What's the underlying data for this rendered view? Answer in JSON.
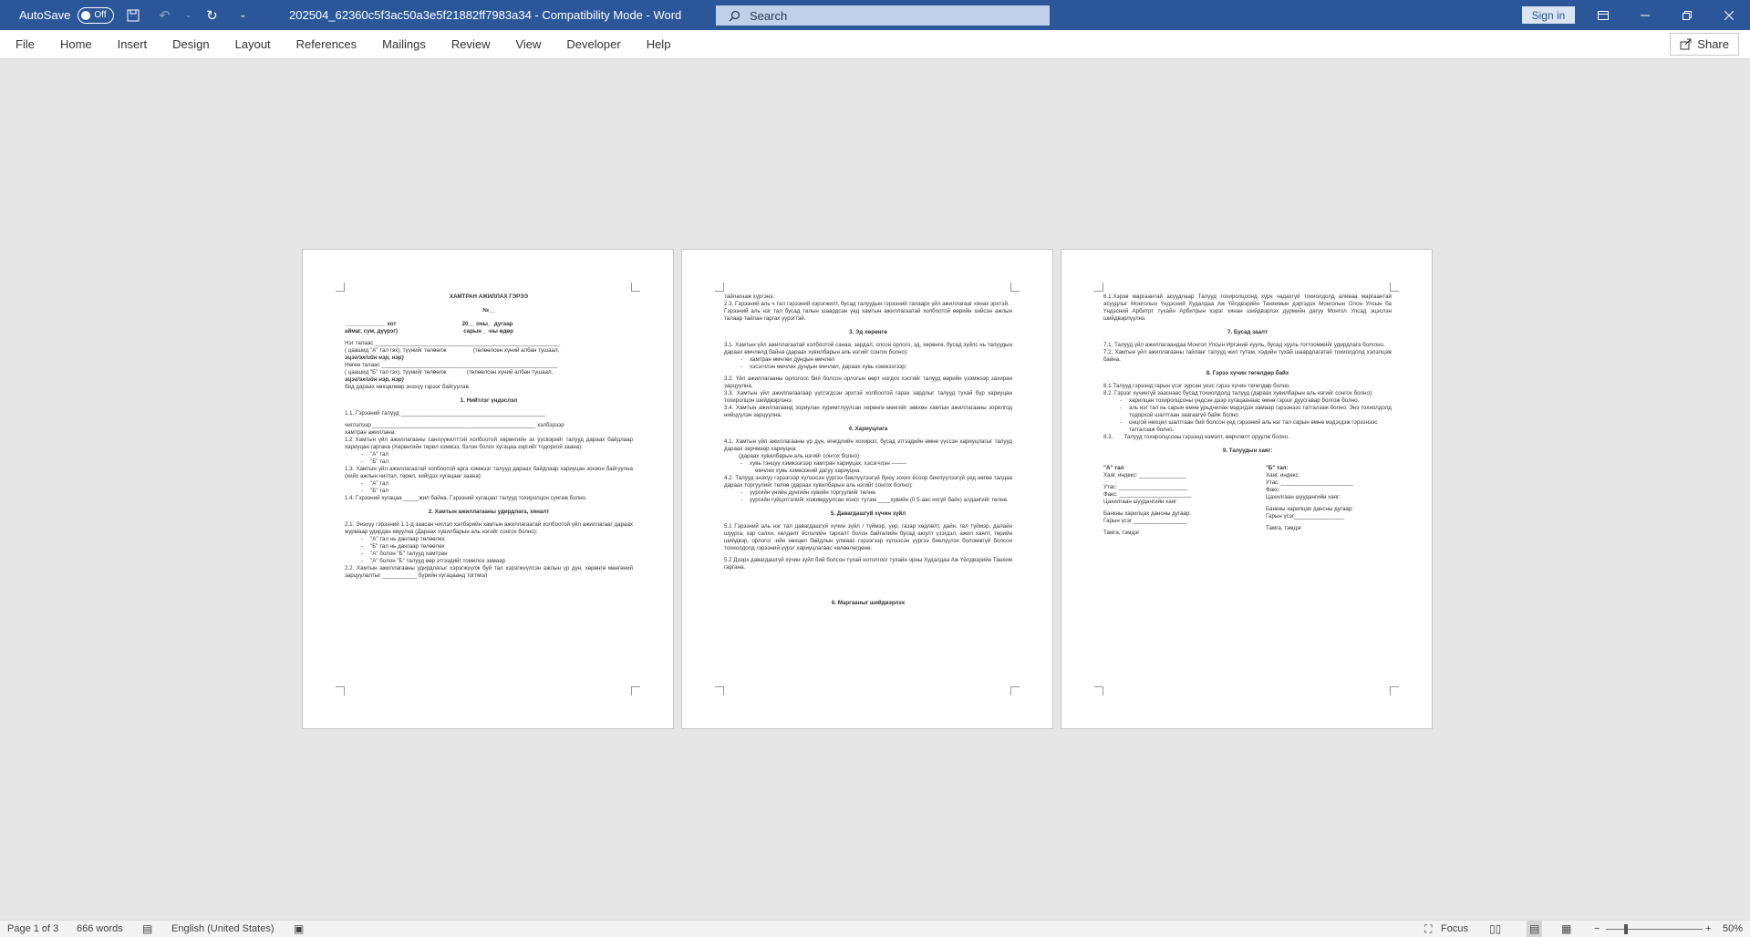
{
  "titlebar": {
    "autosave_label": "AutoSave",
    "autosave_state": "Off",
    "document_title": "202504_62360c5f3ac50a3e5f21882ff7983a34  -  Compatibility Mode  -  Word",
    "search_placeholder": "Search",
    "signin_label": "Sign in"
  },
  "ribbon": {
    "tabs": [
      "File",
      "Home",
      "Insert",
      "Design",
      "Layout",
      "References",
      "Mailings",
      "Review",
      "View",
      "Developer",
      "Help"
    ],
    "share_label": "Share"
  },
  "pages": [
    {
      "title": "ХАМТРАН АЖИЛЛАХ ГЭРЭЭ",
      "number": "№__",
      "city_line": "_____________ хот                                          20__ оны_  дугаар",
      "region_line": "аймаг, сум, дүүрэг)                                          сарын _ -ны өдөр",
      "party_a": "Нэг талаас ___________________________________________________________",
      "party_a_sub": "( цаашид \"А\" тал гэх), түүнийг төлөөлж                 (төлөөлсөн хүний албан тушаал,",
      "party_a_sub2": "эцэг/эх/ийн нэр, нэр)",
      "party_b": "Нөгөө талаас ________________________________________________________",
      "party_b_sub": "( цаашид \"Б\" тал гэх), түүнийг төлөөлж             (төлөөлсөн хүний албан тушаал,",
      "party_b_sub2": "эцэг/эх/ийн нэр, нэр)",
      "intro": "бид дараах нөхцөлөөр энэхүү гэрээг байгуулав.",
      "sec1": "1. Нийтлэг үндэслэл",
      "s1_1": "1.1. Гэрээний талууд ______________________________________________",
      "s1_chiglel": "чиглэлээр ____________________________________________________ хэлбэрээр",
      "s1_tail": "хамтран ажиллана.",
      "s1_2": "1.2 Хамтын үйл ажиллагааны санхүүжилттэй холбоотой хөрөнгийн эх үүсвэрийг талууд дараах байдлаар хариуцан гаргана (Хөрөнгийн төрөл хэмжээ, бэлэн болох хугацаа зэргийг тодорхой заана):",
      "s1_2a": "\"А\" тал",
      "s1_2b": "\"Б\" тал",
      "s1_3": "1.3. Хамтын үйл ажиллагаатай холбоотой арга хэмжээг талууд дараах байдлаар хариуцан зохион байгуулна (хийх ажлын чиглэл, төрөл, хийгдэх хугацааг заана):",
      "s1_3a": "\"А\" тал",
      "s1_3b": "\"Б\" тал",
      "s1_4": "1.4. Гэрээний хугацаа _____жил байна. Гэрээний хугацааг талууд тохиролцон сунгаж болно.",
      "sec2": "2. Хамтын ажиллагааны удирдлага, хяналт",
      "s2_1": "2.1. Энэхүү гэрээний 1.1-д заасан чиглэл хэлбэрийн хамтын ажиллагаатай холбоотой үйл ажиллагааг дараах журмаар удирдан явуулна (Дараах хувилбарын аль нэгийг сонгох болно):",
      "s2_1a": "\"А\" тал нь дангаар төлөөлөх",
      "s2_1b": "\"Б\" тал нь дангаар төлөөлөх",
      "s2_1c": "\"А\" болон \"Б\" талууд хамтран",
      "s2_1d": "\"А\" болон \"Б\" талууд өөр этгээдийг томилох замаар",
      "s2_2": "2.2. Хамтын ажиллагааны удирдлагыг хэрэгжүүлж буй тал хэрэгжүүлсэн ажлын үр дүн, хөрөнгө мөнгөний зарцуулалтыг ___________ бүрийн хугацаанд тогтмол"
    },
    {
      "l1": "тайлагнаж хүргэнэ.",
      "l2": "2.3. Гэрээний аль ч тал гэрээний хэрэгжилт, бусад талуудын гэрээний талаарх үйл ажиллагааг хянах эрхтэй.",
      "l3": "Гэрээний аль нэг тал бусад талын шаардсан үед хамтын ажиллагаатай холбоотой өөрийн хийсэн ажлын талаар тайлан гаргах үүрэгтэй.",
      "sec3": "3. Эд хөрөнгө",
      "s3_1": "3.1. Хамтын үйл ажиллагаатай холбоотой санаа, зардал, олсон орлого, эд, хөрөнгө, бусад зүйлс нь талуудын дараах өмчлөлд байна (дараах хувилбарын аль нэгийг сонгох болно):",
      "s3_1a": "хамтран өмчлөх дундын өмчлөл",
      "s3_1b": "хэсэгчлэн өмчлөх дундын өмчлөл, дараах хувь хэмжээгээр:",
      "s3_2": "3.2. Үйл ажиллагааны орлогоос бий болсон орлогын өөрт ногдох хэсгийг талууд өөрийн үзэмжээр захиран зарцуулна.",
      "s3_3": "3.3. Хамтын үйл ажиллагаагаар үүсгэгдсэн эрхтэй холбоотой гарах зардлыг талууд тухай бүр хариуцан тохиролцон шийдвэрлэнэ.",
      "s3_4": "3.4. Хамтын ажиллагаанд зориулан хуримтлуулсан хөрөнгө мөнгийг зөвхөн хамтын ажиллагааны зорилгод нийцүүлэн зарцуулна.",
      "sec4": "4. Хариуцлага",
      "s4_1": "4.1. Хамтын үйл ажиллагааны үр дүн, өгөгдлийн хохирол, бусад этгээдийн өмнө үүссэн хариуцлагыг талууд дараах зарчмаар хариуцна:",
      "s4_1s": "(дараах хувилбарын аль нэгийг сонгох болно)",
      "s4_1a": "хувь тэнцүү хэмжээгээр хамтран хариуцах, хэсэгчлэн --------",
      "s4_1b": "өмчлөх хувь хэмжээний дагуу хариуцна.",
      "s4_2": "4.2. Талууд энэхүү гэрээгээр хүлээсэн үүргээ биелүүлээгүй буюу зохих ёсоор биелүүлээгүй үед нөгөө талдаа дараах торгуулийг төлнө (дараах хувилбарын аль нэгийг сонгох болно):",
      "s4_2a": "үүргийн үнийн дүнгийн        хувийн торгуулийг төлнө.",
      "s4_2b": "үүргийн гүйцэтгэлийг хожимдуулсан хоног тутам ____хувийн (0.5-аас ихгүй байх) алдангийг төлнө.",
      "sec5": "5. Давагдашгүй хүчин зүйл",
      "s5_1": "5.1 Гэрээний аль нэг тал давагдашгүй хүчин зүйл / түймэр, үер, газар хөдлөлт, дайн, гал түймэр, далайн шуурга, хар салхи, хөлдөлт ёслэлийн тархалт болон байгалийн бусад аюулт үзэгдэл, ажил хаялт, төрийн шийдвэр, орлого/ -ийн нөхцөл байдлын улмаас гэрээгээр хүлээсэн үүргээ биелүүлэх боломжгүй болсон тохиолдолд гэрээний үүрэг хариуцлагаас чөлөөлөгдөнө.",
      "s5_2": "5.2 Дээрх давагдашгүй хүчин зүйл бий болсон тухай нотолгоог тухайн орны Худалдаа Аж Үйлдвэрийн Танхим гаргана.",
      "sec6": "6. Маргааныг шийдвэрлэх"
    },
    {
      "s6_1": "6.1.Хэрэв маргаантай асуудлаар Талууд тохиролцоонд хүрч чадахгүй тохиолдолд аливаа маргаантай асуудлыг Монголын Үндэсний Худалдаа Аж Үйлдвэрийн Танхимын дэргэдэх Монголын Олон Улсын ба Үндэсний Арбитрт тухайн Арбитрын хэрэг хянан шийдвэрлэх дүрмийн дагуу Монгол Улсад эцэслэн шийдвэрлүүлнэ.",
      "sec7": "7. Бусад заалт",
      "s7_1": "7.1. Талууд үйл ажиллагаандаа Монгол Улсын Иргэний хууль, бусад хууль тогтоомжийг удирдлага болгоно.",
      "s7_2": "7.2. Хамтын үйл ажиллагааны тайланг талууд жил тутам, хэдийн тухай шаардлагатай тохиолдолд хэлэлцэж байна.",
      "sec8": "8. Гэрээ хүчин төгөлдөр байх",
      "s8_1": "8.1.Талууд гэрээнд гарын үсэг зурсан үеэс гэрээ хүчин төгөлдөр болно.",
      "s8_2": "8.2. Гэрээг хүчингүй зааснаас бусад тохиолдолд талууд (дараах хувилбарын аль нэгийг сонгох болно):",
      "s8_2a": "харилцан тохиролцсоны үндсэн дээр хугацаанаас өмнө гэрээг дуусгавар болгож болно.",
      "s8_2b": "аль нэг тал нь        сарын өмнө урьдчилан мэдэгдэх замаар гэрээнээс татгалзаж болно. Энэ тохиолдолд тодорхой шалтгаан заагаагүй байж болно",
      "s8_2c": "онцгой нөхцөл шалтгаан бий болсон үед гэрээний аль нэг тал сарын өмнө мэдэгдэж гэрээнээс татгалзаж болно.",
      "s8_3": "8.3.       Талууд тохиролцсоны гэрээнд нэмэлт, өөрчлөлт оруулж болно.",
      "sec9": "9. Талуудын хаяг:",
      "a_head": "\"А\" тал",
      "b_head": "\"Б\" тал:",
      "a_addr": "Хаяг, индекс: _______________",
      "b_addr": "Хаяг, индекс:",
      "a_phone": "Утас: ______________________",
      "b_phone": "Утас: _______________________",
      "a_fax": "Факс: _______________________",
      "b_fax": "Факс:",
      "a_email": "Цахилгаан шуудангийн хаяг:",
      "b_email": "Цахилгаан шуудангийн хаяг:",
      "a_bank": "Банкны харилцах дансны дугаар:",
      "b_bank": "Банкны харилцах дансны дугаар:",
      "a_sign": "Гарын үсэг  _________________",
      "b_sign": "Гарын үсэг________________",
      "a_stamp": "Тамга, тэмдэг",
      "b_stamp": "Тамга, тэмдэг"
    }
  ],
  "statusbar": {
    "page": "Page 1 of 3",
    "words": "666 words",
    "language": "English (United States)",
    "focus": "Focus",
    "zoom": "50%"
  }
}
